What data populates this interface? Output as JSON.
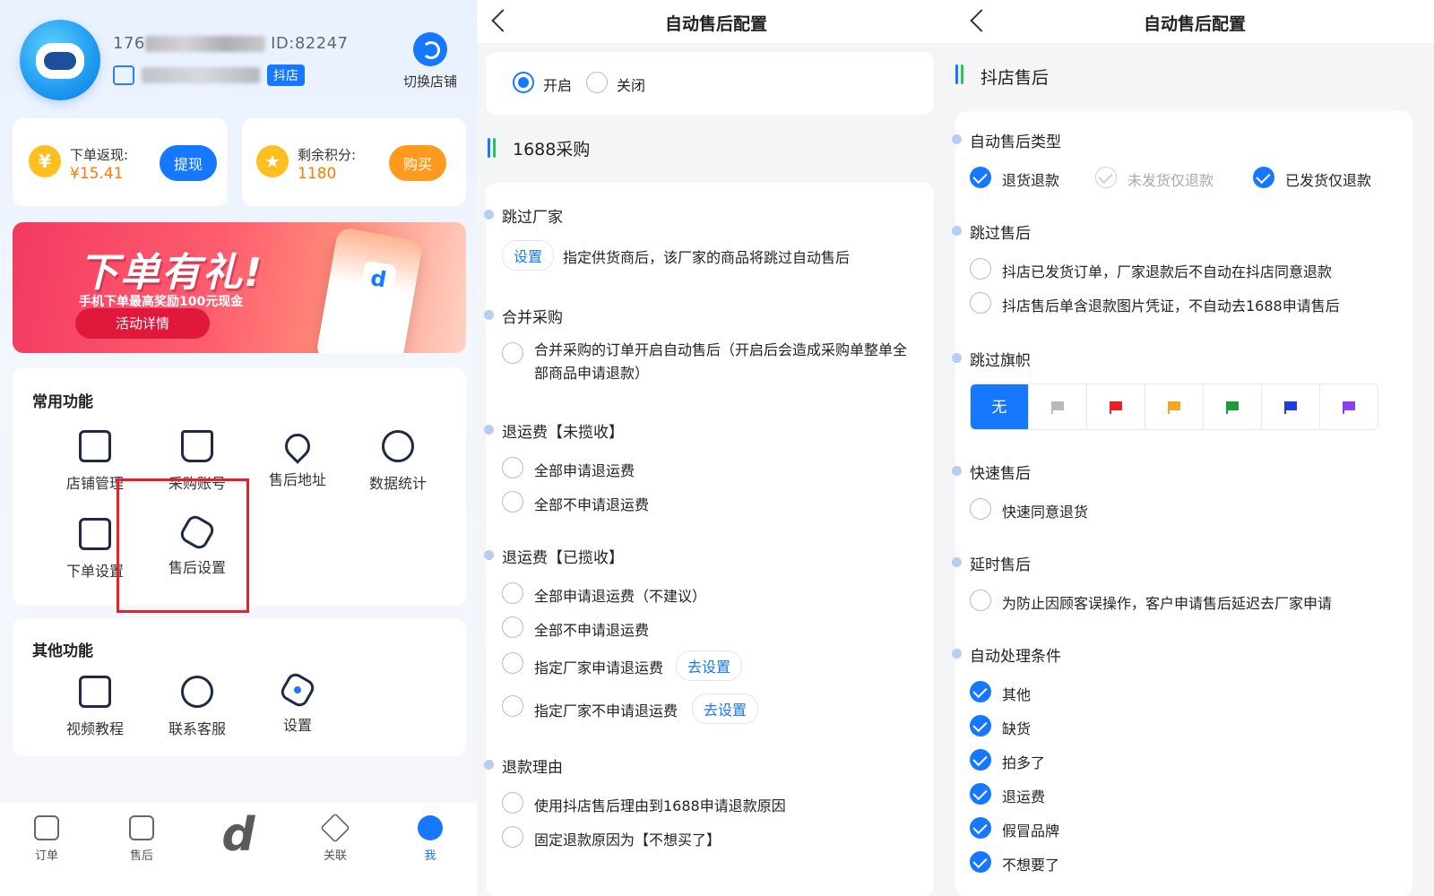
{
  "left": {
    "account": {
      "name_prefix": "176",
      "id_label": "ID:82247",
      "platform_tag": "抖店"
    },
    "switch_store": "切换店铺",
    "rebate": {
      "label": "下单返现:",
      "value": "¥15.41",
      "button": "提现"
    },
    "points": {
      "label": "剩余积分:",
      "value": "1180",
      "button": "购买"
    },
    "banner": {
      "title": "下单有礼!",
      "subtitle": "手机下单最高奖励100元现金",
      "cta": "活动详情"
    },
    "common": {
      "title": "常用功能",
      "items": [
        "店铺管理",
        "采购账号",
        "售后地址",
        "数据统计",
        "下单设置",
        "售后设置"
      ]
    },
    "other": {
      "title": "其他功能",
      "items": [
        "视频教程",
        "联系客服",
        "设置"
      ]
    },
    "tabs": [
      "订单",
      "售后",
      "关联",
      "我"
    ]
  },
  "middle": {
    "nav_title": "自动售后配置",
    "toggle": {
      "on": "开启",
      "off": "关闭"
    },
    "section_title": "1688采购",
    "skip_factory": {
      "label": "跳过厂家",
      "btn": "设置",
      "desc": "指定供货商后，该厂家的商品将跳过自动售后"
    },
    "merge": {
      "label": "合并采购",
      "desc": "合并采购的订单开启自动售后（开启后会造成采购单整单全部商品申请退款）"
    },
    "freight_unpicked": {
      "label": "退运费【未揽收】",
      "opts": [
        "全部申请退运费",
        "全部不申请退运费"
      ]
    },
    "freight_picked": {
      "label": "退运费【已揽收】",
      "opts": [
        "全部申请退运费（不建议）",
        "全部不申请退运费",
        "指定厂家申请退运费",
        "指定厂家不申请退运费"
      ],
      "go_set": "去设置"
    },
    "refund_reason": {
      "label": "退款理由",
      "opts": [
        "使用抖店售后理由到1688申请退款原因",
        "固定退款原因为【不想买了】"
      ]
    }
  },
  "right": {
    "nav_title": "自动售后配置",
    "section_title": "抖店售后",
    "type": {
      "label": "自动售后类型",
      "opts": [
        "退货退款",
        "未发货仅退款",
        "已发货仅退款"
      ]
    },
    "skip_after": {
      "label": "跳过售后",
      "opts": [
        "抖店已发货订单，厂家退款后不自动在抖店同意退款",
        "抖店售后单含退款图片凭证，不自动去1688申请售后"
      ]
    },
    "skip_flag": {
      "label": "跳过旗帜",
      "none": "无",
      "flag_colors": [
        "#b8b8b8",
        "#e8202a",
        "#f5a623",
        "#1f9a3b",
        "#1f3fd6",
        "#8a3ff0"
      ]
    },
    "quick": {
      "label": "快速售后",
      "opt": "快速同意退货"
    },
    "delay": {
      "label": "延时售后",
      "opt": "为防止因顾客误操作，客户申请售后延迟去厂家申请"
    },
    "conditions": {
      "label": "自动处理条件",
      "opts": [
        "其他",
        "缺货",
        "拍多了",
        "退运费",
        "假冒品牌",
        "不想要了"
      ]
    }
  }
}
